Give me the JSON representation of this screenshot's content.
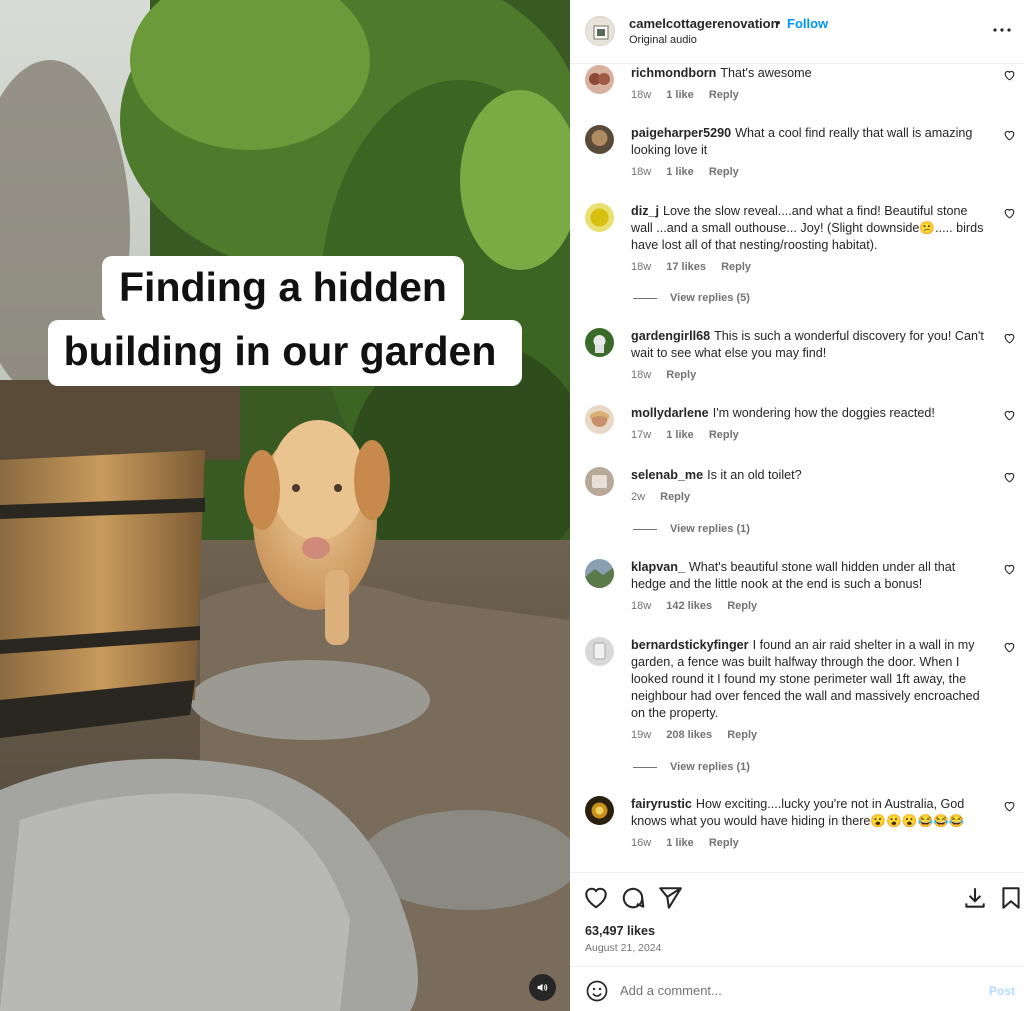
{
  "media": {
    "caption_line1": "Finding a hidden",
    "caption_line2": "building in our garden"
  },
  "header": {
    "username": "camelcottagerenovation",
    "separator": "•",
    "follow_label": "Follow",
    "audio_label": "Original audio"
  },
  "comments": [
    {
      "user": "richmondborn",
      "text": "That's awesome",
      "time": "18w",
      "likes": "1 like",
      "reply": "Reply",
      "avatar_color": "#b87a6a"
    },
    {
      "user": "paigeharper5290",
      "text": "What a cool find really that wall is amazing looking love it",
      "time": "18w",
      "likes": "1 like",
      "reply": "Reply",
      "avatar_color": "#7a5a3a"
    },
    {
      "user": "diz_j",
      "text": "Love the slow reveal....and what a find! Beautiful stone wall ...and a small outhouse... Joy! (Slight downside😕..... birds have lost all of that nesting/roosting habitat).",
      "time": "18w",
      "likes": "17 likes",
      "reply": "Reply",
      "view_replies": "View replies (5)",
      "avatar_color": "#e8d020"
    },
    {
      "user": "gardengirll68",
      "text": "This is such a wonderful discovery for you! Can't wait to see what else you may find!",
      "time": "18w",
      "likes": "",
      "reply": "Reply",
      "avatar_color": "#4a7a3a"
    },
    {
      "user": "mollydarlene",
      "text": "I'm wondering how the doggies reacted!",
      "time": "17w",
      "likes": "1 like",
      "reply": "Reply",
      "avatar_color": "#c89a70"
    },
    {
      "user": "selenab_me",
      "text": "Is it an old toilet?",
      "time": "2w",
      "likes": "",
      "reply": "Reply",
      "view_replies": "View replies (1)",
      "avatar_color": "#a89888"
    },
    {
      "user": "klapvan_",
      "text": "What's beautiful stone wall hidden under all that hedge and the little nook at the end is such a bonus!",
      "time": "18w",
      "likes": "142 likes",
      "reply": "Reply",
      "avatar_color": "#6a8a6a"
    },
    {
      "user": "bernardstickyfinger",
      "text": "I found an air raid shelter in a wall in my garden, a fence was built halfway through the door. When I looked round it I found my stone perimeter wall 1ft away, the neighbour had over fenced the wall and massively encroached on the property.",
      "time": "19w",
      "likes": "208 likes",
      "reply": "Reply",
      "view_replies": "View replies (1)",
      "avatar_color": "#c8c8c8"
    },
    {
      "user": "fairyrustic",
      "text": "How exciting....lucky you're not in Australia, God knows what you would have hiding in there😮😮😮😂😂😂",
      "time": "16w",
      "likes": "1 like",
      "reply": "Reply",
      "avatar_color": "#8a6a20"
    }
  ],
  "actions": {
    "likes_count": "63,497 likes",
    "date": "August 21, 2024"
  },
  "add_comment": {
    "placeholder": "Add a comment...",
    "post_label": "Post"
  }
}
